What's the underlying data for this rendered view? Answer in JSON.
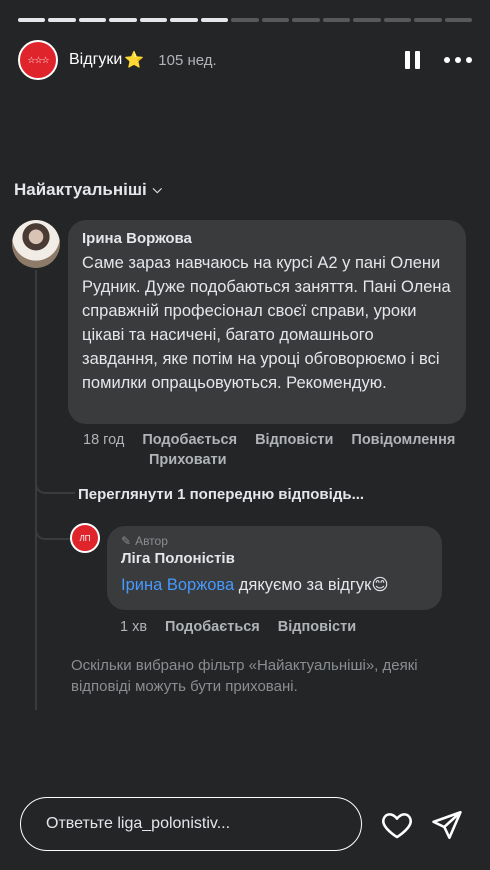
{
  "story": {
    "progress_total": 15,
    "progress_done": 7
  },
  "header": {
    "avatar_label": "☆☆☆",
    "title": "Відгуки",
    "star": "⭐",
    "time": "105 нед."
  },
  "filter": {
    "label": "Найактуальніші",
    "chevron": "⌵"
  },
  "comment": {
    "author": "Ірина Воржова",
    "text": "Саме зараз навчаюсь на курсі А2 у пані Олени Рудник. Дуже подобаються заняття. Пані Олена справжній професіонал своєї справи, уроки цікаві та насичені, багато домашнього завдання, яке потім на уроці обговорюємо і всі помилки опрацьовуються. Рекомендую.",
    "time": "18 год",
    "like": "Подобається",
    "reply": "Відповісти",
    "message": "Повідомлення",
    "hide": "Приховати"
  },
  "view_previous": "Переглянути 1 попередню відповідь...",
  "reply": {
    "badge": "Автор",
    "author": "Ліга Полоністів",
    "avatar_label": "ЛП",
    "mention": "Ірина Воржова",
    "text": " дякуємо за відгук",
    "emoji": "😊",
    "time": "1 хв",
    "like": "Подобається",
    "reply": "Відповісти"
  },
  "notice": "Оскільки вибрано фільтр «Найактуальніші», деякі відповіді можуть бути приховані.",
  "composer": {
    "placeholder": "Ответьте liga_polonistiv..."
  },
  "colors": {
    "background": "#242526",
    "bubble": "#3a3b3c",
    "mention": "#4599ff",
    "brand": "#e0242b"
  }
}
